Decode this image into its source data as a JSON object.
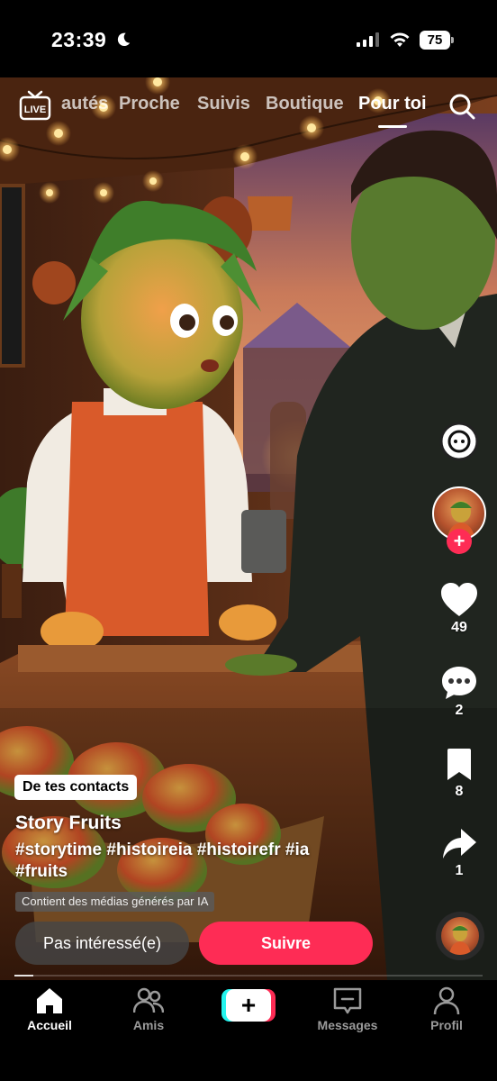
{
  "status_bar": {
    "time": "23:39",
    "battery": "75"
  },
  "top_tabs": {
    "items": [
      {
        "label": "autés"
      },
      {
        "label": "Proche"
      },
      {
        "label": "Suivis"
      },
      {
        "label": "Boutique"
      },
      {
        "label": "Pour toi"
      }
    ],
    "active": "Pour toi"
  },
  "rail": {
    "likes": "49",
    "comments": "2",
    "saves": "8",
    "shares": "1"
  },
  "caption": {
    "contact_badge": "De tes contacts",
    "author": "Story Fruits",
    "hashtags": "#storytime #histoireia #histoirefr #ia #fruits",
    "ai_label": "Contient des médias générés par IA"
  },
  "actions": {
    "not_interested": "Pas intéressé(e)",
    "follow": "Suivre"
  },
  "progress": 0.04,
  "bottom_nav": {
    "home": "Accueil",
    "friends": "Amis",
    "messages": "Messages",
    "profile": "Profil",
    "active": "Accueil"
  },
  "colors": {
    "brand_red": "#fe2c55",
    "brand_cyan": "#25f4ee"
  }
}
